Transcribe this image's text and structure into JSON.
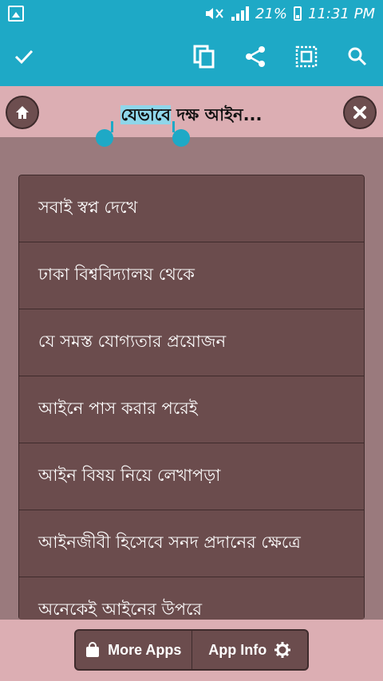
{
  "status_bar": {
    "battery": "21%",
    "time": "11:31 PM"
  },
  "header": {
    "title_selected": "যেভাবে",
    "title_rest": " দক্ষ আইন...",
    "icons": [
      "check-icon",
      "copy-icon",
      "share-icon",
      "select-all-icon",
      "search-icon",
      "home-icon",
      "close-icon"
    ]
  },
  "list": {
    "items": [
      "সবাই স্বপ্ন দেখে",
      "ঢাকা বিশ্ববিদ্যালয় থেকে",
      "যে সমস্ত যোগ্যতার প্রয়োজন",
      "আইনে পাস করার পরেই",
      "আইন বিষয় নিয়ে লেখাপড়া",
      "আইনজীবী হিসেবে সনদ প্রদানের ক্ষেত্রে",
      "অনেকেই আইনের উপরে"
    ]
  },
  "bottom": {
    "more_apps": "More Apps",
    "app_info": "App Info"
  },
  "colors": {
    "accent": "#1ea9c6",
    "item_bg": "#6b4c4d",
    "bar_bg": "#dcaeb3",
    "page_bg": "#9a7a7d"
  }
}
